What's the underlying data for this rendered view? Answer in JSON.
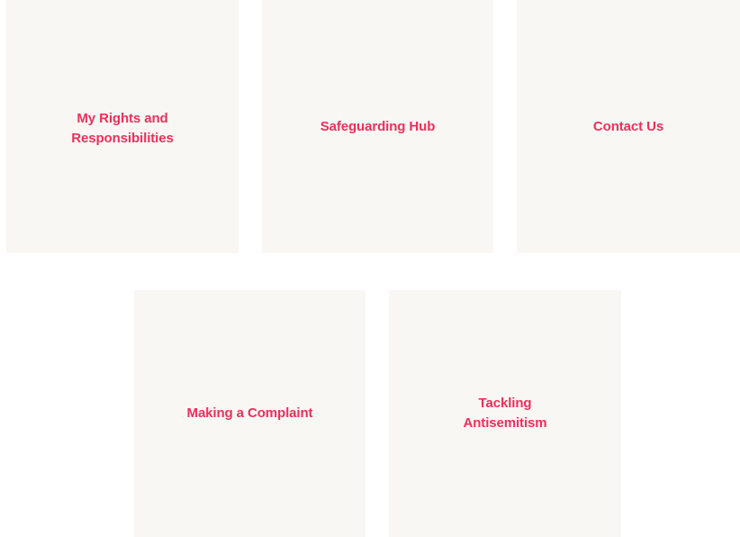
{
  "colors": {
    "card_background": "#f9f7f4",
    "link_text": "#ee2f5a",
    "page_background": "#ffffff"
  },
  "cards": [
    {
      "label": "My Rights and\nResponsibilities"
    },
    {
      "label": "Safeguarding Hub"
    },
    {
      "label": "Contact Us"
    },
    {
      "label": "Making a Complaint"
    },
    {
      "label": "Tackling\nAntisemitism"
    }
  ]
}
